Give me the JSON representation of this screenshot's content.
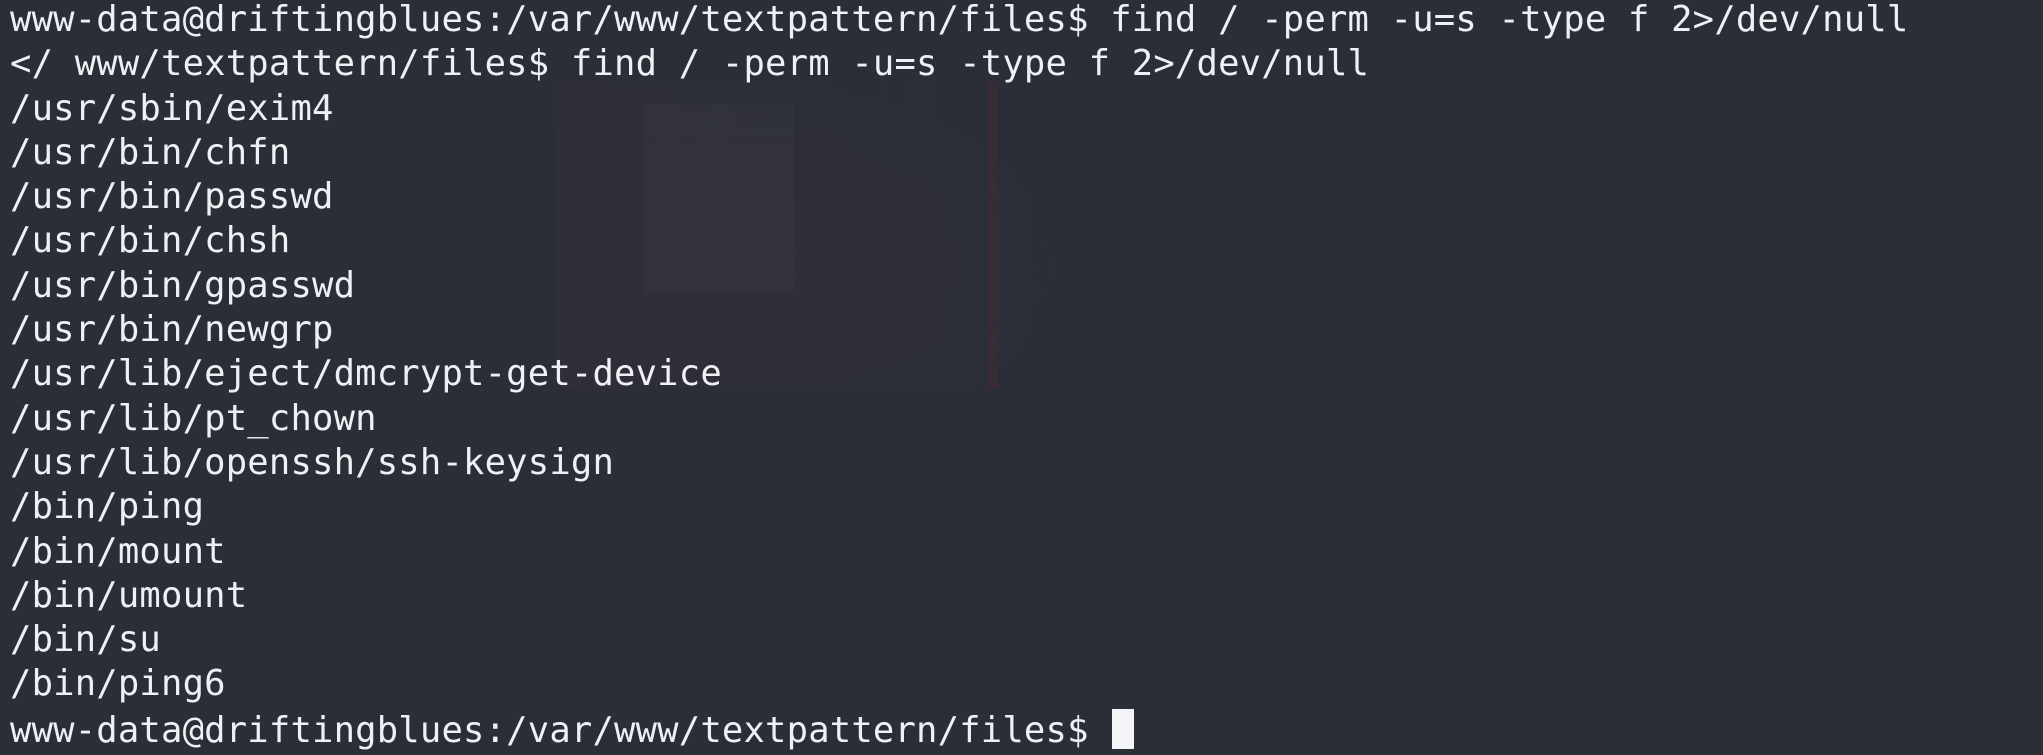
{
  "terminal": {
    "command_line": "www-data@driftingblues:/var/www/textpattern/files$ find / -perm -u=s -type f 2>/dev/null",
    "echo_line": "</ www/textpattern/files$ find / -perm -u=s -type f 2>/dev/null",
    "output": [
      "/usr/sbin/exim4",
      "/usr/bin/chfn",
      "/usr/bin/passwd",
      "/usr/bin/chsh",
      "/usr/bin/gpasswd",
      "/usr/bin/newgrp",
      "/usr/lib/eject/dmcrypt-get-device",
      "/usr/lib/pt_chown",
      "/usr/lib/openssh/ssh-keysign",
      "/bin/ping",
      "/bin/mount",
      "/bin/umount",
      "/bin/su",
      "/bin/ping6"
    ],
    "prompt": "www-data@driftingblues:/var/www/textpattern/files$ "
  }
}
